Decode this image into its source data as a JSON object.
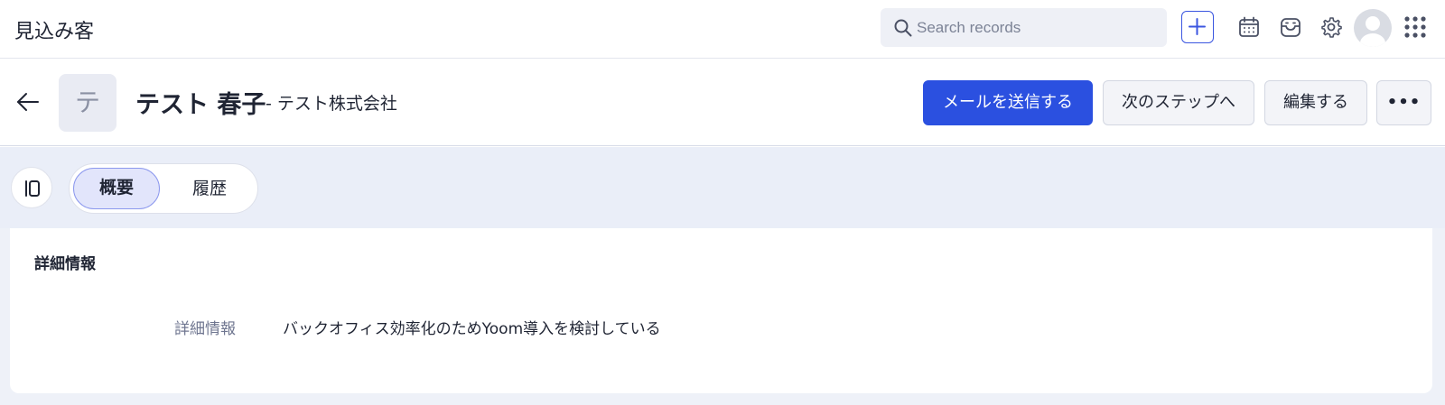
{
  "app": {
    "title": "見込み客"
  },
  "search": {
    "placeholder": "Search records"
  },
  "top_icons": [
    "plus-icon",
    "calendar-icon",
    "inbox-icon",
    "gear-icon",
    "avatar",
    "apps-grid-icon"
  ],
  "record": {
    "avatar_initial": "テ",
    "name": "テスト 春子",
    "company": "- テスト株式会社"
  },
  "actions": {
    "send_email": "メールを送信する",
    "next_step": "次のステップへ",
    "edit": "編集する",
    "more": "•••"
  },
  "tabs": [
    {
      "label": "概要",
      "active": true
    },
    {
      "label": "履歴",
      "active": false
    }
  ],
  "details": {
    "section_title": "詳細情報",
    "fields": [
      {
        "label": "詳細情報",
        "value": "バックオフィス効率化のためYoom導入を検討している"
      }
    ]
  },
  "colors": {
    "primary": "#2b50e0",
    "band": "#eaeef8",
    "active_tab": "#e2e5fb"
  }
}
